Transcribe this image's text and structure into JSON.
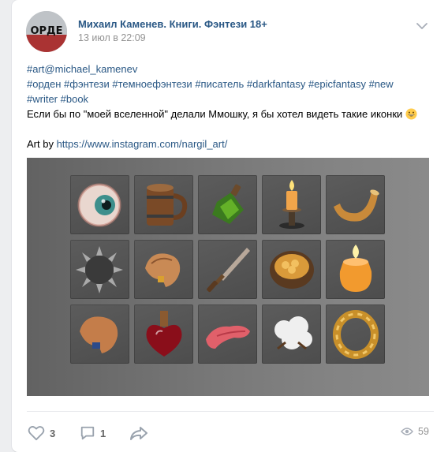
{
  "post": {
    "author": "Михаил Каменев. Книги. Фэнтези 18+",
    "date": "13 июл в 22:09",
    "avatar_text": "ОРДЕ",
    "lines": {
      "line1": "#art@michael_kamenev",
      "line2_tags": [
        "#орден",
        "#фэнтези",
        "#темноефэнтези",
        "#писатель",
        "#darkfantasy",
        "#epicfantasy",
        "#new"
      ],
      "line3_tags": [
        "#writer",
        "#book"
      ],
      "line4": "Если бы по \"моей вселенной\" делали Ммошку, я бы хотел видеть такие иконки",
      "credit_prefix": "Art by ",
      "credit_link": "https://www.instagram.com/nargil_art/"
    }
  },
  "actions": {
    "likes": "3",
    "comments": "1",
    "views": "59"
  },
  "colors": {
    "link": "#2a5885",
    "muted": "#939393",
    "icon": "#99a2ad"
  },
  "icons": [
    "chevron-down-icon",
    "heart-icon",
    "comment-icon",
    "share-icon",
    "eye-icon",
    "grinning-emoji"
  ],
  "photo_items": [
    "eye",
    "wooden-mug",
    "green-potion",
    "candlestick",
    "horn",
    "spiked-mace-ball",
    "hair-lock",
    "dagger",
    "coin-bowl",
    "candle",
    "hair-lock-2",
    "red-potion",
    "tongue",
    "cotton",
    "gold-ring"
  ]
}
